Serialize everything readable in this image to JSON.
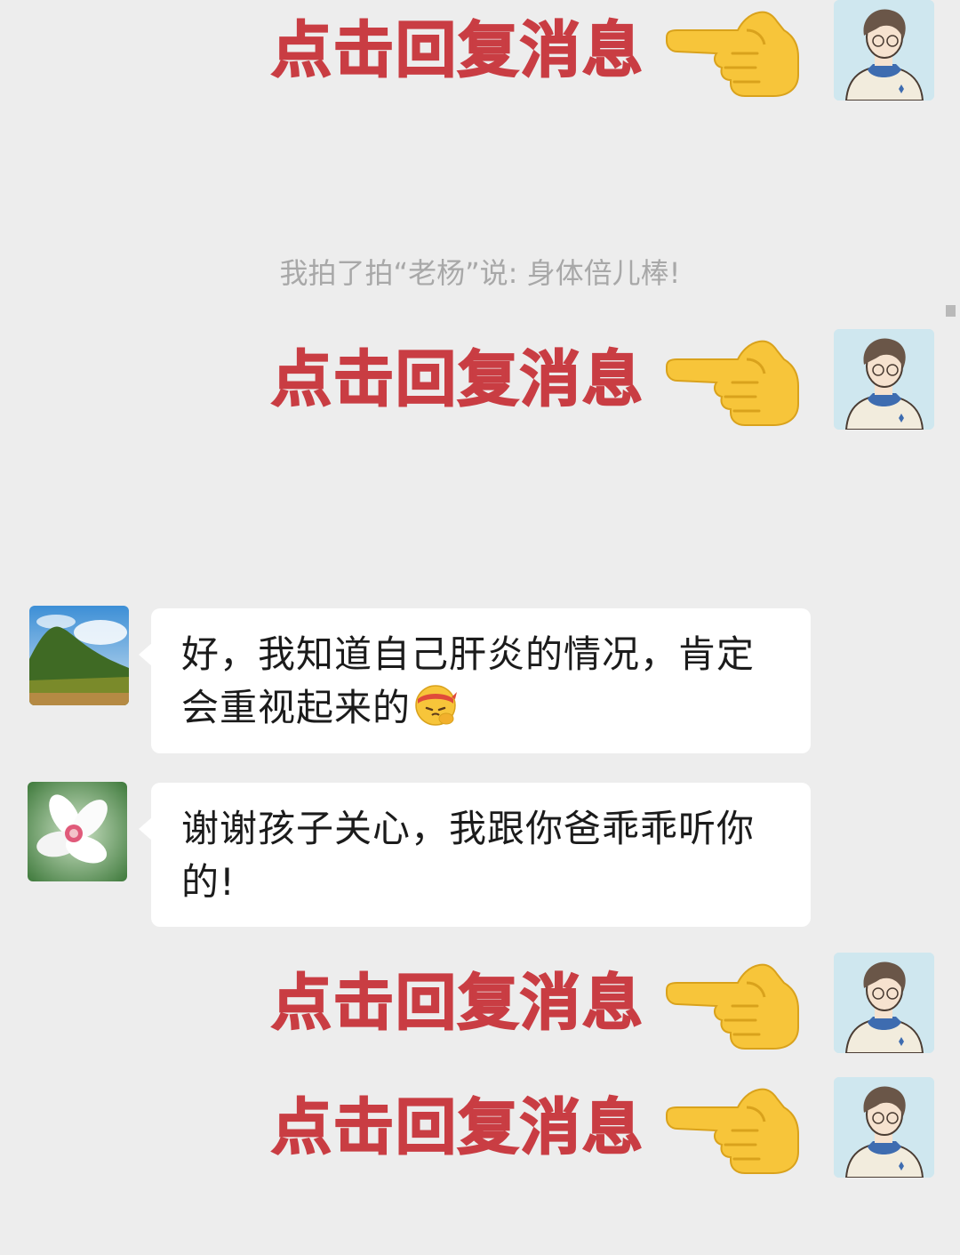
{
  "reply_prompts": [
    {
      "text": "点击回复消息"
    },
    {
      "text": "点击回复消息"
    },
    {
      "text": "点击回复消息"
    },
    {
      "text": "点击回复消息"
    }
  ],
  "system_note": "我拍了拍“老杨”说: 身体倍儿棒!",
  "messages": [
    {
      "text": "好，我知道自己肝炎的情况，肯定会重视起来的",
      "emoji": "saluting-face-with-headband-icon"
    },
    {
      "text": "谢谢孩子关心，我跟你爸乖乖听你的!"
    }
  ],
  "colors": {
    "background": "#ededed",
    "prompt_red": "#c93d43",
    "bubble": "#ffffff",
    "system_text": "#a8a8a8",
    "hand_yellow": "#f7c53a"
  }
}
